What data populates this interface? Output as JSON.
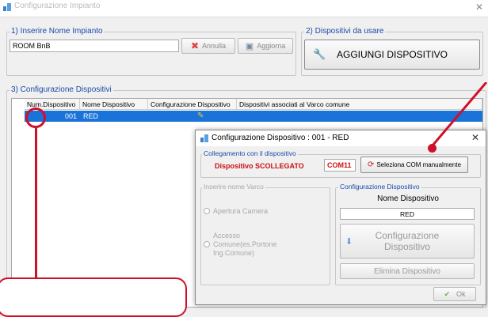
{
  "window": {
    "title": "Configurazione Impianto"
  },
  "section1": {
    "label": "1) Inserire Nome Impianto",
    "plant_name": "ROOM BnB",
    "cancel_label": "Annulla",
    "update_label": "Aggiorna"
  },
  "section2": {
    "label": "2) Dispositivi da usare",
    "add_device_label": "AGGIUNGI DISPOSITIVO"
  },
  "section3": {
    "label": "3) Configurazione Dispositivi",
    "columns": [
      "Num.Dispositivo",
      "Nome Dispositivo",
      "Configurazione Dispositivo",
      "Dispositivi associati al Varco comune"
    ],
    "rows": [
      {
        "num": "001",
        "name": "RED",
        "assoc": ""
      }
    ]
  },
  "dialog": {
    "title": "Configurazione Dispositivo : 001 - RED",
    "connection_label": "Collegamento con il dispositivo",
    "status": "Dispositivo SCOLLEGATO",
    "com_port": "COM11",
    "select_com_label": "Seleziona COM manualmente",
    "varco_label": "Inserire nome Varco",
    "radio_camera": "Apertura Camera",
    "radio_comune": "Accesso Comune(es.Portone Ing.Comune)",
    "config_label": "Configurazione Dispositivo",
    "device_name_label": "Nome Dispositivo",
    "device_name_value": "RED",
    "configure_btn": "Configurazione Dispositivo",
    "delete_btn": "Elimina Dispositivo",
    "ok_label": "Ok"
  },
  "colors": {
    "accent_red": "#d0102a",
    "selection_blue": "#1a73d9",
    "group_label_blue": "#1b4aa8"
  }
}
